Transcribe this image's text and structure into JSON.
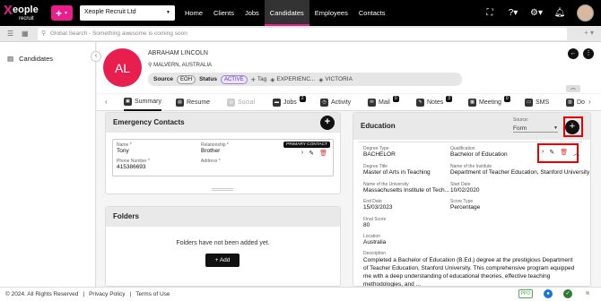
{
  "topbar": {
    "logo_word": "eople",
    "logo_mark": "X",
    "logo_sub": "recruit",
    "company": "Xeople Recruit Ltd",
    "nav": [
      "Home",
      "Clients",
      "Jobs",
      "Candidates",
      "Employees",
      "Contacts"
    ],
    "active_nav": "Candidates"
  },
  "search": {
    "placeholder": "Global Search - Something awesome is coming soon"
  },
  "sidebar": {
    "items": [
      {
        "label": "Candidates"
      }
    ]
  },
  "candidate": {
    "initials": "AL",
    "name": "ABRAHAM LINCOLN",
    "location": "MALVERN, AUSTRALIA",
    "source_label": "Source",
    "source_value": "EOH",
    "status_label": "Status",
    "status_value": "ACTIVE",
    "tag_label": "Tag",
    "tags": [
      "EXPERIENC...",
      "VICTORIA"
    ]
  },
  "tabs": [
    {
      "label": "Summary",
      "active": true
    },
    {
      "label": "Resume"
    },
    {
      "label": "Social",
      "disabled": true
    },
    {
      "label": "Jobs",
      "count": "2"
    },
    {
      "label": "Activity"
    },
    {
      "label": "Mail",
      "count": "0"
    },
    {
      "label": "Notes",
      "count": "3"
    },
    {
      "label": "Meeting",
      "count": "0"
    },
    {
      "label": "SMS"
    },
    {
      "label": "Do"
    }
  ],
  "emergency": {
    "title": "Emergency Contacts",
    "badge": "PRIMARY CONTACT",
    "name_label": "Name *",
    "name": "Tony",
    "rel_label": "Relationship *",
    "rel": "Brother",
    "phone_label": "Phone Number *",
    "phone": "415386693",
    "addr_label": "Address *",
    "addr": ""
  },
  "folders": {
    "title": "Folders",
    "empty": "Folders have not been added yet.",
    "add_label": "Add"
  },
  "education": {
    "title": "Education",
    "source_label": "Source:",
    "source_value": "Form",
    "fields": {
      "degree_type": {
        "label": "Degree Type",
        "value": "BACHELOR"
      },
      "qualification": {
        "label": "Qualification",
        "value": "Bachelor of Education"
      },
      "degree_title": {
        "label": "Degree Title",
        "value": "Master of Arts in Teaching"
      },
      "institute": {
        "label": "Name of the Institute",
        "value": "Department of Teacher Education, Stanford University"
      },
      "university": {
        "label": "Name of the University",
        "value": "Massachusetts Institute of Tech..."
      },
      "start_date": {
        "label": "Start Date",
        "value": "10/02/2020"
      },
      "end_date": {
        "label": "End Date",
        "value": "15/03/2023"
      },
      "score_type": {
        "label": "Score Type",
        "value": "Percentage"
      },
      "final_score": {
        "label": "Final Score",
        "value": "80"
      },
      "location": {
        "label": "Location",
        "value": "Australia"
      },
      "description": {
        "label": "Description",
        "value": "Completed a Bachelor of Education (B.Ed.) degree at the prestigious Department of Teacher Education, Stanford University. This comprehensive program equipped me with a deep understanding of educational theories, effective teaching methodologies, and ..."
      }
    }
  },
  "footer": {
    "copyright": "© 2024. All Rights Reserved",
    "privacy": "Privacy Policy",
    "terms": "Terms of Use",
    "ppd": "PPD"
  },
  "colors": {
    "brand": "#e91e8c",
    "avatar": "#e81e4f",
    "highlight": "#e00000"
  }
}
